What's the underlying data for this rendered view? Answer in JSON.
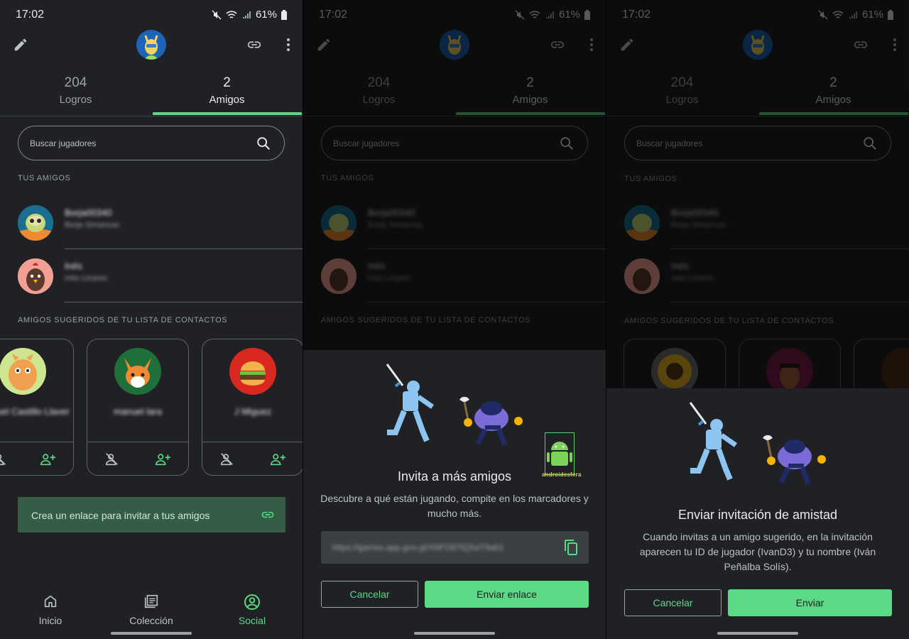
{
  "status": {
    "time": "17:02",
    "battery": "61%"
  },
  "stats": {
    "achievements_count": "204",
    "achievements_label": "Logros",
    "friends_count": "2",
    "friends_label": "Amigos"
  },
  "search": {
    "placeholder": "Buscar jugadores"
  },
  "friends_section": "TUS AMIGOS",
  "friends": [
    {
      "name": "Borja00340",
      "sub": "Borja Simancas"
    },
    {
      "name": "Inés",
      "sub": "Inés Linares"
    }
  ],
  "suggested_section": "AMIGOS SUGERIDOS DE TU LISTA DE CONTACTOS",
  "suggested": [
    {
      "name": "Miguel Castillo Llaver"
    },
    {
      "name": "manuel lara"
    },
    {
      "name": "J Miguez"
    }
  ],
  "invite_link_text": "Crea un enlace para invitar a tus amigos",
  "nav": {
    "home": "Inicio",
    "collection": "Colección",
    "social": "Social"
  },
  "dialog_link": {
    "title": "Invita a más amigos",
    "description": "Descubre a qué están jugando, compite en los marcadores y mucho más.",
    "url": "https://games.app.goo.gl/XNFD87tQ5aY9ab1",
    "cancel": "Cancelar",
    "send": "Enviar enlace"
  },
  "dialog_invite": {
    "title": "Enviar invitación de amistad",
    "description": "Cuando invitas a un amigo sugerido, en la invitación aparecen tu ID de jugador (IvanD3) y tu nombre (Iván Peñalba Solís).",
    "cancel": "Cancelar",
    "send": "Enviar"
  },
  "watermark": "androidesfera",
  "colors": {
    "accent": "#5bd985",
    "background": "#202124",
    "link_banner": "#355d45"
  },
  "icons": [
    "edit-icon",
    "link-icon",
    "more-vert-icon",
    "search-icon",
    "person-remove-icon",
    "person-add-icon",
    "home-icon",
    "collection-icon",
    "social-icon",
    "copy-icon"
  ]
}
